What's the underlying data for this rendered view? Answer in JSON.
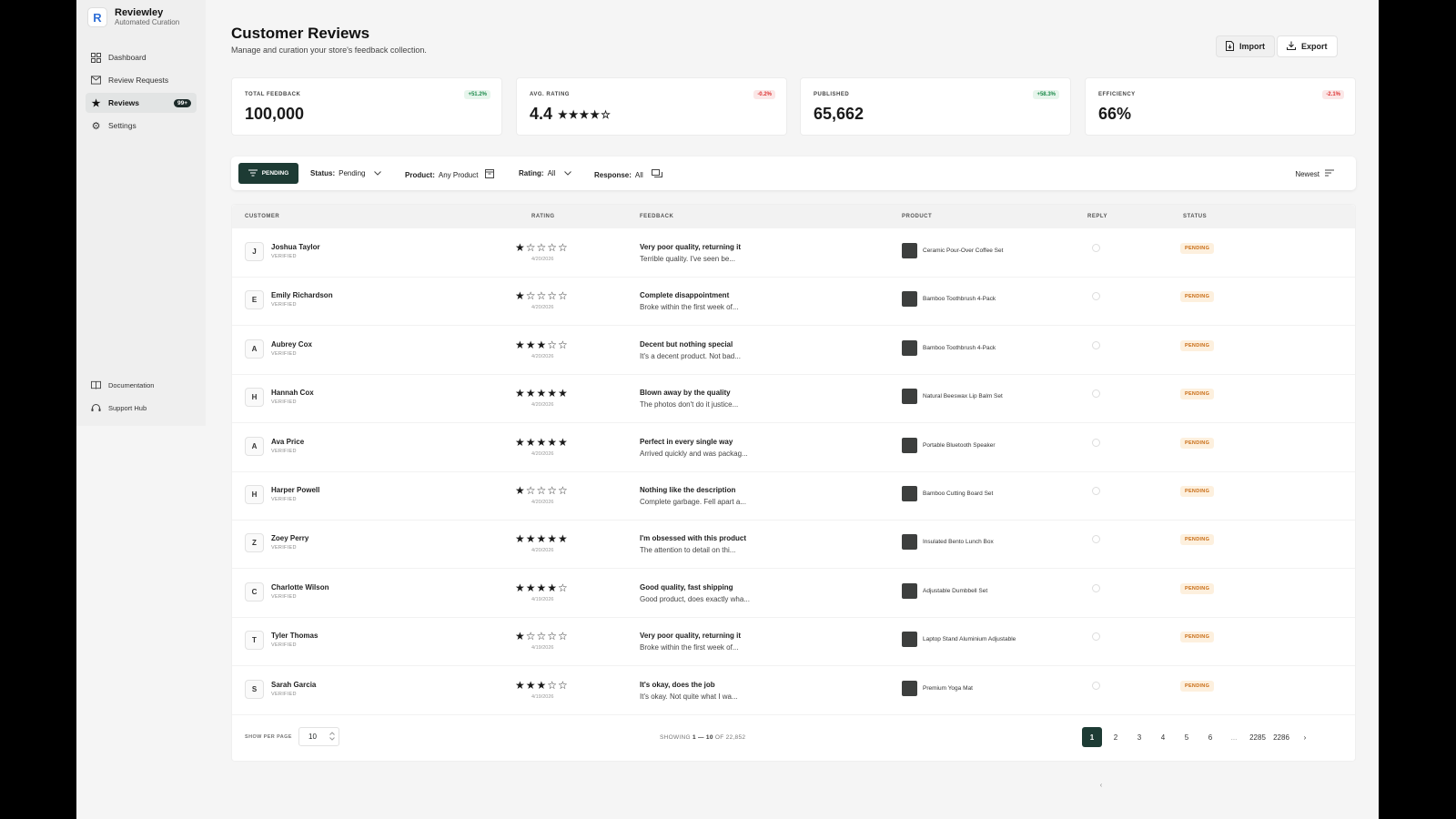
{
  "brand": {
    "name": "Reviewley",
    "sub": "Automated Curation",
    "logo_letter": "R"
  },
  "nav": [
    {
      "label": "Dashboard",
      "icon": "grid-icon"
    },
    {
      "label": "Review Requests",
      "icon": "mail-icon"
    },
    {
      "label": "Reviews",
      "icon": "star-icon",
      "badge": "99+",
      "active": true
    },
    {
      "label": "Settings",
      "icon": "gear-icon"
    }
  ],
  "nav_bottom": [
    {
      "label": "Documentation",
      "icon": "book-icon"
    },
    {
      "label": "Support Hub",
      "icon": "headset-icon"
    }
  ],
  "header": {
    "title": "Customer Reviews",
    "subtitle": "Manage and curation your store's feedback collection.",
    "import_label": "Import",
    "export_label": "Export"
  },
  "stats": [
    {
      "label": "TOTAL FEEDBACK",
      "value": "100,000",
      "delta": "+51.2%",
      "trend": "up"
    },
    {
      "label": "AVG. RATING",
      "value": "4.4",
      "stars": "★★★★☆",
      "delta": "-0.2%",
      "trend": "down"
    },
    {
      "label": "PUBLISHED",
      "value": "65,662",
      "delta": "+58.3%",
      "trend": "up"
    },
    {
      "label": "EFFICIENCY",
      "value": "66%",
      "delta": "-2.1%",
      "trend": "down"
    }
  ],
  "filters": {
    "chip": "PENDING",
    "status_label": "Status:",
    "status_value": "Pending",
    "product_label": "Product:",
    "product_value": "Any Product",
    "rating_label": "Rating:",
    "rating_value": "All",
    "response_label": "Response:",
    "response_value": "All",
    "sort": "Newest"
  },
  "table": {
    "headers": {
      "customer": "CUSTOMER",
      "rating": "RATING",
      "feedback": "FEEDBACK",
      "product": "PRODUCT",
      "reply": "REPLY",
      "status": "STATUS"
    },
    "rows": [
      {
        "initial": "J",
        "name": "Joshua Taylor",
        "verified": "VERIFIED",
        "stars": "★☆☆☆☆",
        "date": "4/20/2026",
        "title": "Very poor quality, returning it",
        "body": "Terrible quality. I've seen be...",
        "product": "Ceramic Pour-Over Coffee Set",
        "status": "PENDING"
      },
      {
        "initial": "E",
        "name": "Emily Richardson",
        "verified": "VERIFIED",
        "stars": "★☆☆☆☆",
        "date": "4/20/2026",
        "title": "Complete disappointment",
        "body": "Broke within the first week of...",
        "product": "Bamboo Toothbrush 4-Pack",
        "status": "PENDING"
      },
      {
        "initial": "A",
        "name": "Aubrey Cox",
        "verified": "VERIFIED",
        "stars": "★★★☆☆",
        "date": "4/20/2026",
        "title": "Decent but nothing special",
        "body": "It's a decent product. Not bad...",
        "product": "Bamboo Toothbrush 4-Pack",
        "status": "PENDING"
      },
      {
        "initial": "H",
        "name": "Hannah Cox",
        "verified": "VERIFIED",
        "stars": "★★★★★",
        "date": "4/20/2026",
        "title": "Blown away by the quality",
        "body": "The photos don't do it justice...",
        "product": "Natural Beeswax Lip Balm Set",
        "status": "PENDING"
      },
      {
        "initial": "A",
        "name": "Ava Price",
        "verified": "VERIFIED",
        "stars": "★★★★★",
        "date": "4/20/2026",
        "title": "Perfect in every single way",
        "body": "Arrived quickly and was packag...",
        "product": "Portable Bluetooth Speaker",
        "status": "PENDING"
      },
      {
        "initial": "H",
        "name": "Harper Powell",
        "verified": "VERIFIED",
        "stars": "★☆☆☆☆",
        "date": "4/20/2026",
        "title": "Nothing like the description",
        "body": "Complete garbage. Fell apart a...",
        "product": "Bamboo Cutting Board Set",
        "status": "PENDING"
      },
      {
        "initial": "Z",
        "name": "Zoey Perry",
        "verified": "VERIFIED",
        "stars": "★★★★★",
        "date": "4/20/2026",
        "title": "I'm obsessed with this product",
        "body": "The attention to detail on thi...",
        "product": "Insulated Bento Lunch Box",
        "status": "PENDING"
      },
      {
        "initial": "C",
        "name": "Charlotte Wilson",
        "verified": "VERIFIED",
        "stars": "★★★★☆",
        "date": "4/19/2026",
        "title": "Good quality, fast shipping",
        "body": "Good product, does exactly wha...",
        "product": "Adjustable Dumbbell Set",
        "status": "PENDING"
      },
      {
        "initial": "T",
        "name": "Tyler Thomas",
        "verified": "VERIFIED",
        "stars": "★☆☆☆☆",
        "date": "4/19/2026",
        "title": "Very poor quality, returning it",
        "body": "Broke within the first week of...",
        "product": "Laptop Stand Aluminium Adjustable",
        "status": "PENDING"
      },
      {
        "initial": "S",
        "name": "Sarah Garcia",
        "verified": "VERIFIED",
        "stars": "★★★☆☆",
        "date": "4/19/2026",
        "title": "It's okay, does the job",
        "body": "It's okay. Not quite what I wa...",
        "product": "Premium Yoga Mat",
        "status": "PENDING"
      }
    ]
  },
  "footer": {
    "per_page_label": "SHOW PER PAGE",
    "per_page_value": "10",
    "showing_prefix": "SHOWING",
    "showing_range": "1 — 10",
    "showing_suffix": "OF 22,852",
    "pages": [
      "1",
      "2",
      "3",
      "4",
      "5",
      "6",
      "...",
      "2285",
      "2286"
    ],
    "current_page": "1"
  },
  "colors": {
    "accent": "#1d3b34",
    "pending": "#c86b12",
    "up": "#1b8a4a",
    "down": "#dd3333"
  }
}
